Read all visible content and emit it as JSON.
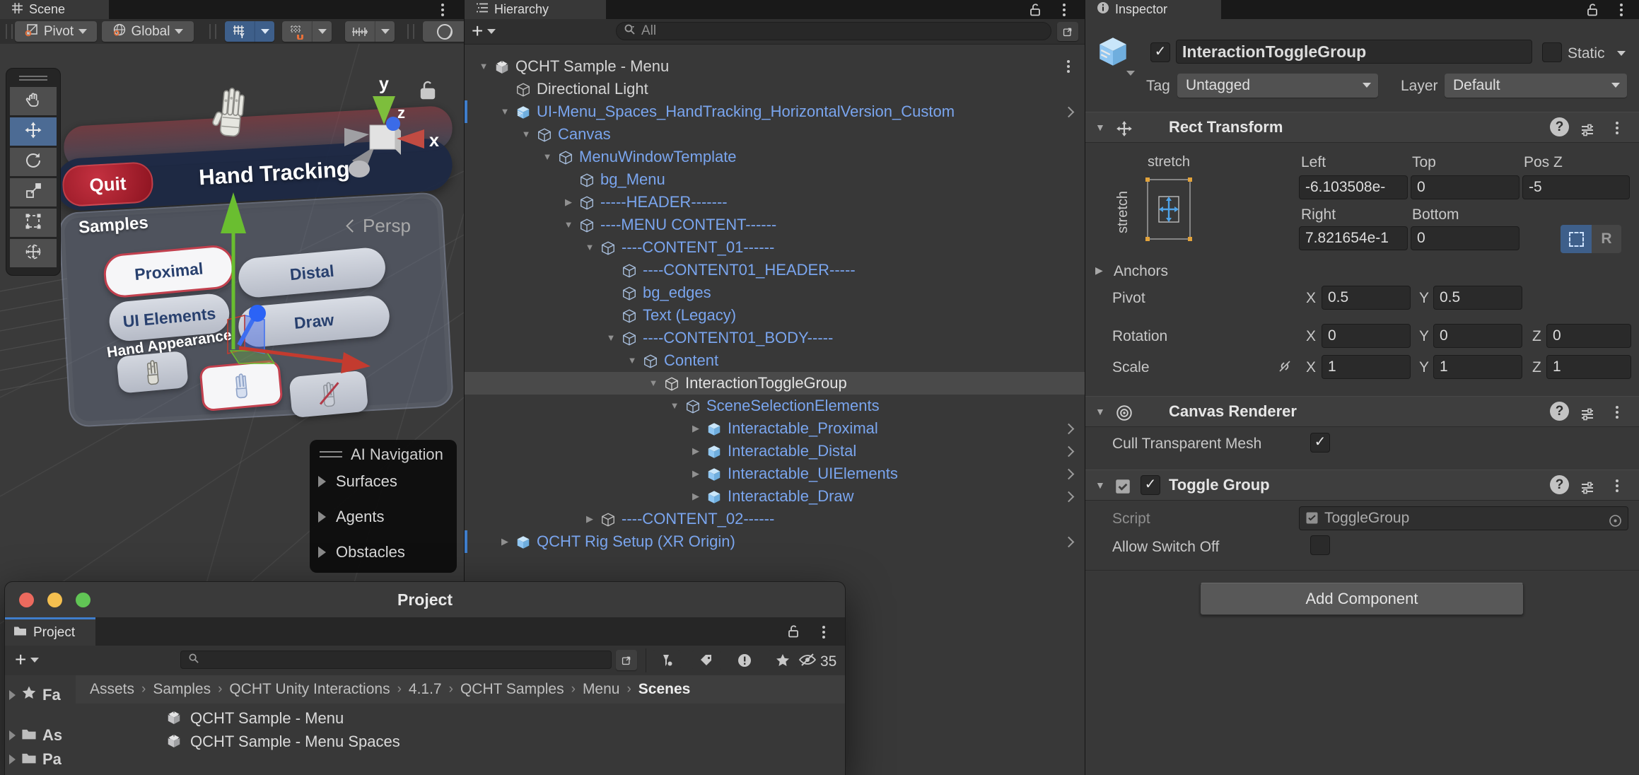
{
  "scene": {
    "tab": "Scene",
    "toolbar": {
      "pivot": "Pivot",
      "global": "Global"
    },
    "tools": [
      "pan",
      "move",
      "rotate",
      "scale",
      "rect",
      "transform"
    ],
    "active_tool": "move",
    "persp_label": "Persp",
    "axis_labels": {
      "y": "y",
      "z": "z",
      "x": "x"
    },
    "menu": {
      "quit": "Quit",
      "title": "Hand Tracking",
      "samples": "Samples",
      "buttons": [
        "Proximal",
        "Distal",
        "UI Elements",
        "Draw"
      ],
      "selected_button": "Proximal",
      "hand_appearance": "Hand Appearance",
      "hand_buttons": [
        "robot-hand",
        "ghost-hand",
        "disabled-hand"
      ],
      "selected_hand": "ghost-hand"
    },
    "ai_navigation": {
      "title": "AI Navigation",
      "items": [
        "Surfaces",
        "Agents",
        "Obstacles"
      ]
    }
  },
  "hierarchy": {
    "tab": "Hierarchy",
    "search_placeholder": "All",
    "rows": [
      {
        "label": "QCHT Sample - Menu",
        "level": 0,
        "tone": "white",
        "icon": "scene",
        "arrow": "open",
        "kebab": true
      },
      {
        "label": "Directional Light",
        "level": 1,
        "tone": "white",
        "icon": "cube",
        "arrow": "none"
      },
      {
        "label": "UI-Menu_Spaces_HandTracking_HorizontalVersion_Custom",
        "level": 1,
        "tone": "blue",
        "icon": "prefab-variant",
        "arrow": "open",
        "chevron": true,
        "bar": true
      },
      {
        "label": "Canvas",
        "level": 2,
        "tone": "blue",
        "icon": "cube-blue",
        "arrow": "open"
      },
      {
        "label": "MenuWindowTemplate",
        "level": 3,
        "tone": "blue",
        "icon": "cube-blue",
        "arrow": "open"
      },
      {
        "label": "bg_Menu",
        "level": 4,
        "tone": "blue",
        "icon": "cube-blue",
        "arrow": "none"
      },
      {
        "label": "-----HEADER-------",
        "level": 4,
        "tone": "blue",
        "icon": "cube-blue",
        "arrow": "closed"
      },
      {
        "label": "----MENU CONTENT------",
        "level": 4,
        "tone": "blue",
        "icon": "cube-blue",
        "arrow": "open"
      },
      {
        "label": "----CONTENT_01------",
        "level": 5,
        "tone": "blue",
        "icon": "cube-blue",
        "arrow": "open"
      },
      {
        "label": "----CONTENT01_HEADER-----",
        "level": 6,
        "tone": "blue",
        "icon": "cube-blue",
        "arrow": "none"
      },
      {
        "label": "bg_edges",
        "level": 6,
        "tone": "blue",
        "icon": "cube-blue",
        "arrow": "none"
      },
      {
        "label": "Text (Legacy)",
        "level": 6,
        "tone": "blue",
        "icon": "cube-blue",
        "arrow": "none"
      },
      {
        "label": "----CONTENT01_BODY-----",
        "level": 6,
        "tone": "blue",
        "icon": "cube-blue",
        "arrow": "open"
      },
      {
        "label": "Content",
        "level": 7,
        "tone": "blue",
        "icon": "cube-blue",
        "arrow": "open"
      },
      {
        "label": "InteractionToggleGroup",
        "level": 8,
        "tone": "sel",
        "icon": "cube-light",
        "arrow": "open",
        "selected": true
      },
      {
        "label": "SceneSelectionElements",
        "level": 9,
        "tone": "blue",
        "icon": "cube-blue",
        "arrow": "open"
      },
      {
        "label": "Interactable_Proximal",
        "level": 10,
        "tone": "blue",
        "icon": "prefab",
        "arrow": "closed",
        "chevron": true
      },
      {
        "label": "Interactable_Distal",
        "level": 10,
        "tone": "blue",
        "icon": "prefab",
        "arrow": "closed",
        "chevron": true
      },
      {
        "label": "Interactable_UIElements",
        "level": 10,
        "tone": "blue",
        "icon": "prefab",
        "arrow": "closed",
        "chevron": true
      },
      {
        "label": "Interactable_Draw",
        "level": 10,
        "tone": "blue",
        "icon": "prefab",
        "arrow": "closed",
        "chevron": true
      },
      {
        "label": "----CONTENT_02------",
        "level": 5,
        "tone": "blue",
        "icon": "cube",
        "arrow": "closed"
      },
      {
        "label": "QCHT Rig Setup (XR Origin)",
        "level": 1,
        "tone": "blue",
        "icon": "prefab",
        "arrow": "closed",
        "chevron": true,
        "bar": true
      }
    ]
  },
  "inspector": {
    "tab": "Inspector",
    "header": {
      "name": "InteractionToggleGroup",
      "active": "✓",
      "static_label": "Static",
      "tag_label": "Tag",
      "tag_value": "Untagged",
      "layer_label": "Layer",
      "layer_value": "Default"
    },
    "rect_transform": {
      "title": "Rect Transform",
      "anchor_h": "stretch",
      "anchor_v": "stretch",
      "left_label": "Left",
      "left": "-6.103508e-",
      "top_label": "Top",
      "top": "0",
      "posz_label": "Pos Z",
      "posz": "-5",
      "right_label": "Right",
      "right": "7.821654e-1",
      "bottom_label": "Bottom",
      "bottom": "0",
      "anchors_label": "Anchors",
      "pivot_label": "Pivot",
      "pivot_x": "0.5",
      "pivot_y": "0.5",
      "rotation_label": "Rotation",
      "rotation": {
        "x": "0",
        "y": "0",
        "z": "0"
      },
      "scale_label": "Scale",
      "scale": {
        "x": "1",
        "y": "1",
        "z": "1"
      },
      "axis": {
        "x": "X",
        "y": "Y",
        "z": "Z"
      },
      "r_button": "R"
    },
    "canvas_renderer": {
      "title": "Canvas Renderer",
      "cull_label": "Cull Transparent Mesh",
      "cull": "✓"
    },
    "toggle_group": {
      "title": "Toggle Group",
      "enabled": "✓",
      "script_label": "Script",
      "script_value": "ToggleGroup",
      "allow_label": "Allow Switch Off"
    },
    "add_component": "Add Component"
  },
  "project": {
    "window_title": "Project",
    "tab": "Project",
    "sidebar": [
      {
        "icon": "star",
        "label": "Fa"
      },
      {
        "icon": "folder",
        "label": "As"
      },
      {
        "icon": "folder",
        "label": "Pa"
      }
    ],
    "breadcrumbs": [
      "Assets",
      "Samples",
      "QCHT Unity Interactions",
      "4.1.7",
      "QCHT Samples",
      "Menu",
      "Scenes"
    ],
    "files": [
      "QCHT Sample - Menu",
      "QCHT Sample - Menu Spaces"
    ],
    "hidden_count": "35"
  },
  "colors": {
    "accent_blue": "#3F7ECC",
    "prefab_blue": "#7AA5EE",
    "tool_selected": "#4C6B94",
    "quit_red": "#A61E2A",
    "selection_row": "#4A4A4A",
    "panel": "#383838"
  }
}
